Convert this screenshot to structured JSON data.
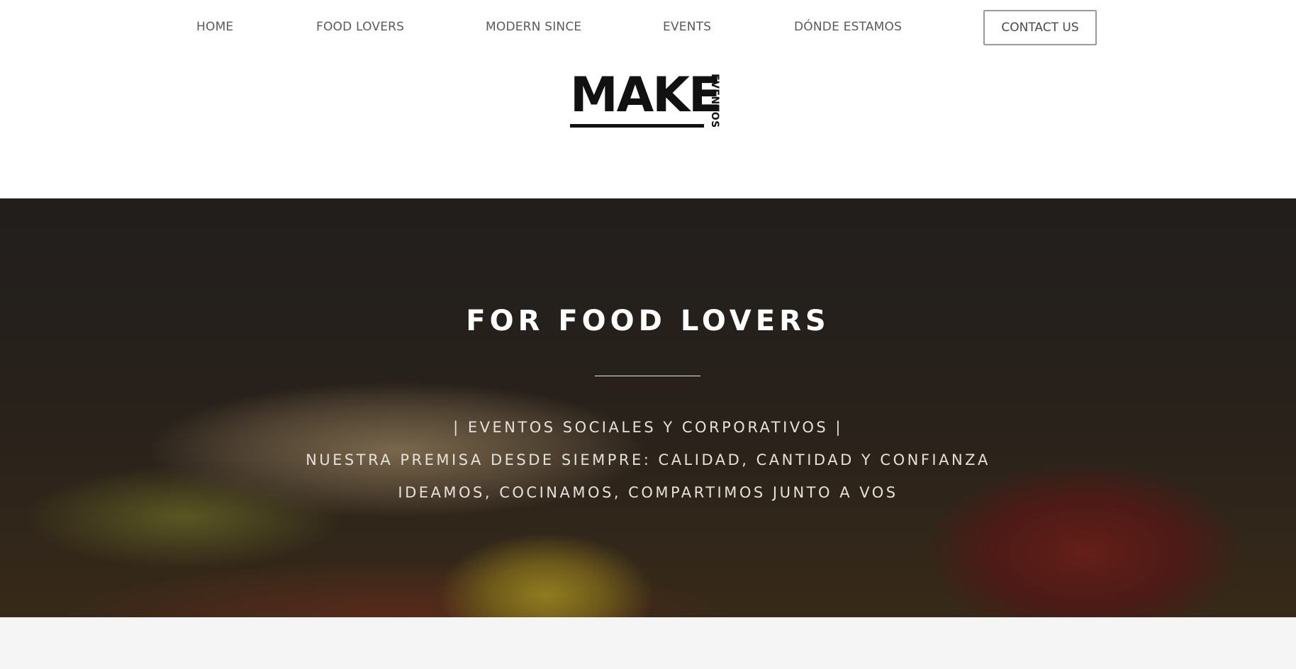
{
  "nav": {
    "items": [
      {
        "label": "HOME"
      },
      {
        "label": "FOOD LOVERS"
      },
      {
        "label": "MODERN SINCE"
      },
      {
        "label": "EVENTS"
      },
      {
        "label": "DÓNDE ESTAMOS"
      }
    ],
    "contact_label": "CONTACT US"
  },
  "logo": {
    "main": "MAKE",
    "side": "EVENTOS"
  },
  "hero": {
    "title": "FOR FOOD LOVERS",
    "line1": "| EVENTOS SOCIALES Y CORPORATIVOS |",
    "line2": "NUESTRA PREMISA DESDE SIEMPRE: CALIDAD, CANTIDAD Y CONFIANZA",
    "line3": "IDEAMOS, COCINAMOS, COMPARTIMOS JUNTO A VOS"
  }
}
